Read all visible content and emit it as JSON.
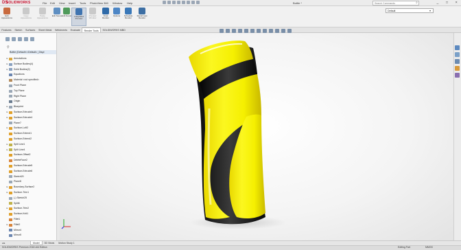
{
  "app": {
    "logo_mark": "DS",
    "logo_text": "SOLIDWORKS"
  },
  "menu": [
    "File",
    "Edit",
    "View",
    "Insert",
    "Tools",
    "PhotoView 360",
    "Window",
    "Help"
  ],
  "document_title": "Bottle *",
  "search": {
    "placeholder": "Search Commands"
  },
  "window_buttons": [
    "_",
    "□",
    "×"
  ],
  "ribbon": {
    "buttons": [
      {
        "label": "Edit Appearance",
        "enabled": true
      },
      {
        "label": "Copy Appearance",
        "enabled": false
      },
      {
        "label": "Paste Appearance",
        "enabled": false
      },
      {
        "label": "Edit Scene",
        "enabled": true
      },
      {
        "label": "Edit Decal",
        "enabled": true
      },
      {
        "label": "Integrated Preview",
        "enabled": true,
        "active": true
      },
      {
        "label": "Preview Window",
        "enabled": false
      },
      {
        "label": "Final Render",
        "enabled": true
      },
      {
        "label": "Options",
        "enabled": true
      },
      {
        "label": "Schedule Render",
        "enabled": true
      },
      {
        "label": "Recall Last Render",
        "enabled": true
      }
    ],
    "configuration": "Default"
  },
  "command_tabs": [
    "Features",
    "Sketch",
    "Surfaces",
    "Sheet Metal",
    "Weldments",
    "Evaluate",
    "Render Tools",
    "SOLIDWORKS MBD"
  ],
  "selected_command_tab": "Render Tools",
  "tree": {
    "root": "Bottle (Default<<Default>_Displ",
    "items": [
      {
        "label": "Annotations",
        "expand": "▸",
        "icon": "#d8a640"
      },
      {
        "label": "Surface Bodies(4)",
        "expand": "▸",
        "icon": "#8aa1bf"
      },
      {
        "label": "Solid Bodies(2)",
        "expand": "▸",
        "icon": "#8aa1bf"
      },
      {
        "label": "Equations",
        "expand": "",
        "icon": "#6b86b0"
      },
      {
        "label": "Material <not specified>",
        "expand": "",
        "icon": "#b58b5a"
      },
      {
        "label": "Front Plane",
        "expand": "",
        "icon": "#9aa7b5"
      },
      {
        "label": "Top Plane",
        "expand": "",
        "icon": "#9aa7b5"
      },
      {
        "label": "Right Plane",
        "expand": "",
        "icon": "#9aa7b5"
      },
      {
        "label": "Origin",
        "expand": "",
        "icon": "#6b7c8f"
      },
      {
        "label": "Blueprint",
        "expand": "▸",
        "icon": "#9aa7b5"
      },
      {
        "label": "Surface-Extrude3",
        "expand": "▸",
        "icon": "#e0a02a"
      },
      {
        "label": "Surface-Extrude4",
        "expand": "▸",
        "icon": "#e0a02a"
      },
      {
        "label": "Plane7",
        "expand": "",
        "icon": "#9aa7b5"
      },
      {
        "label": "Surface-Loft2",
        "expand": "▸",
        "icon": "#e0a02a"
      },
      {
        "label": "Surface-Extend1",
        "expand": "",
        "icon": "#e0a02a"
      },
      {
        "label": "Surface-Extend2",
        "expand": "",
        "icon": "#e0a02a"
      },
      {
        "label": "Split Line1",
        "expand": "▸",
        "icon": "#c0b24a"
      },
      {
        "label": "Split Line4",
        "expand": "▸",
        "icon": "#c0b24a"
      },
      {
        "label": "Surface-Offset2",
        "expand": "",
        "icon": "#e0a02a"
      },
      {
        "label": "DeleteFace2",
        "expand": "",
        "icon": "#d8843a"
      },
      {
        "label": "Surface-Extrude5",
        "expand": "",
        "icon": "#e0a02a"
      },
      {
        "label": "Surface-Extrude6",
        "expand": "",
        "icon": "#e0a02a"
      },
      {
        "label": "Sketch20",
        "expand": "",
        "icon": "#9aa7b5"
      },
      {
        "label": "Plane8",
        "expand": "",
        "icon": "#9aa7b5"
      },
      {
        "label": "Boundary-Surface2",
        "expand": "▸",
        "icon": "#e0a02a"
      },
      {
        "label": "Surface-Trim1",
        "expand": "▸",
        "icon": "#e0a02a"
      },
      {
        "label": "(-) Sketch25",
        "expand": "",
        "icon": "#9aa7b5"
      },
      {
        "label": "Split6",
        "expand": "",
        "icon": "#c0b24a"
      },
      {
        "label": "Surface-Trim2",
        "expand": "▸",
        "icon": "#e0a02a"
      },
      {
        "label": "Surface-Knit1",
        "expand": "",
        "icon": "#e0a02a"
      },
      {
        "label": "Fillet1",
        "expand": "",
        "icon": "#d8843a"
      },
      {
        "label": "Fillet2",
        "expand": "▸",
        "icon": "#d8843a"
      },
      {
        "label": "Mirror4",
        "expand": "",
        "icon": "#6b86b0"
      },
      {
        "label": "Mirror5",
        "expand": "",
        "icon": "#6b86b0"
      }
    ]
  },
  "bottom_tabs": [
    "Model",
    "3D Views",
    "Motion Study 1"
  ],
  "selected_bottom_tab": "Model",
  "status": {
    "left": "SOLIDWORKS Premium 2018 x64 Edition",
    "mode": "Editing Part",
    "units": "MMGS"
  },
  "model": {
    "body_color": "#f4f000",
    "accent_color": "#151515"
  }
}
